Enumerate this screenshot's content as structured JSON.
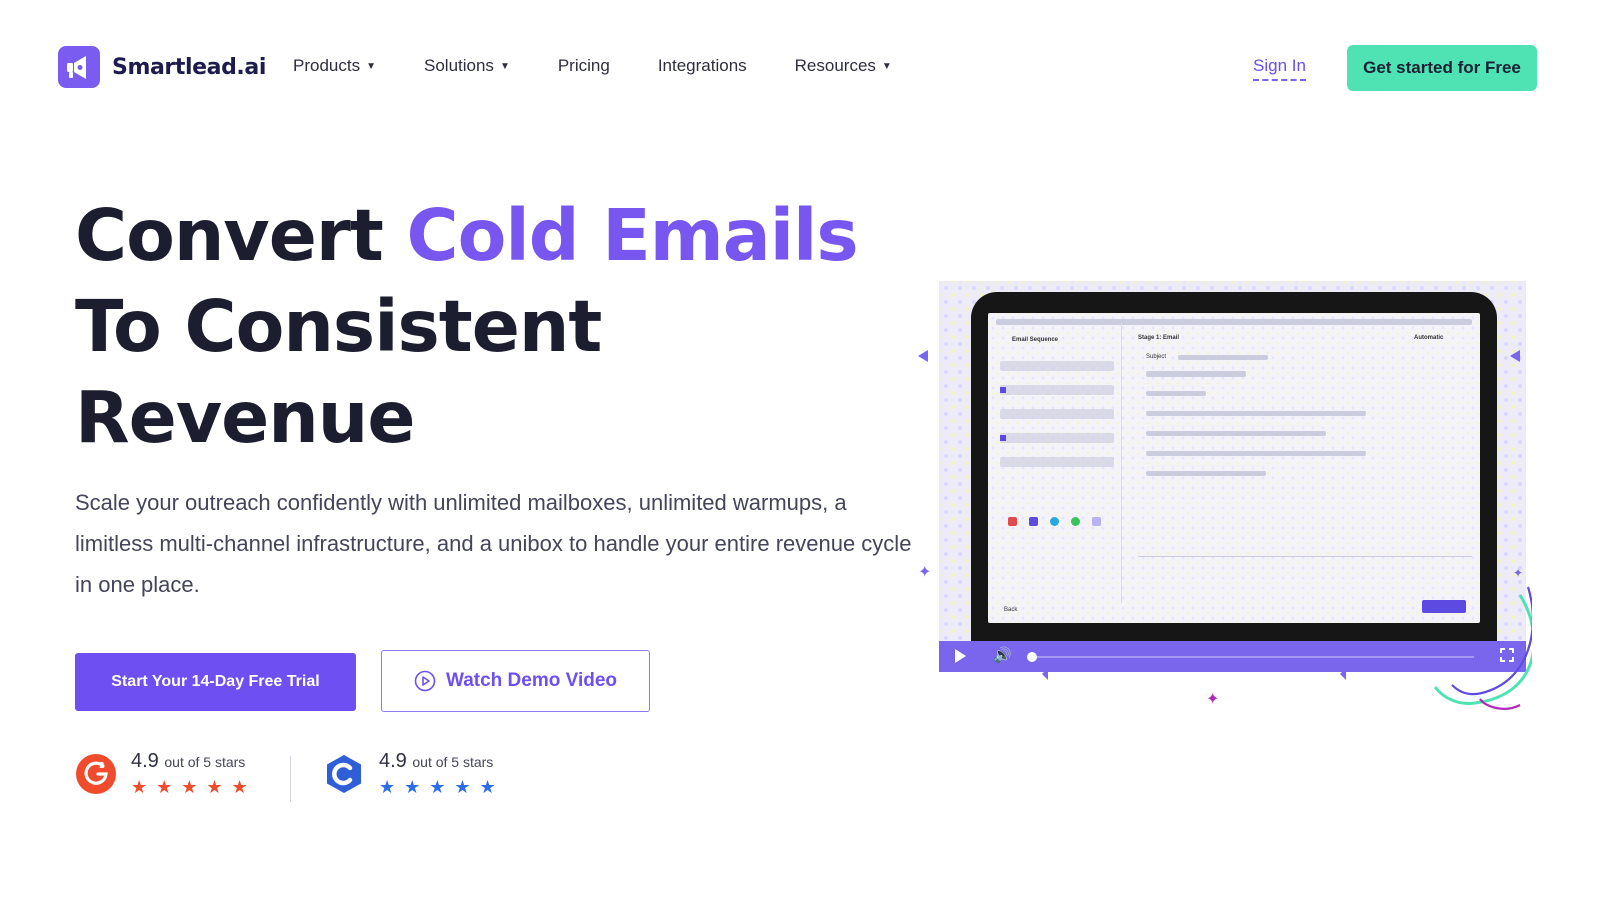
{
  "brand": {
    "name": "Smartlead.ai"
  },
  "nav": {
    "items": [
      {
        "label": "Products",
        "has_dropdown": true
      },
      {
        "label": "Solutions",
        "has_dropdown": true
      },
      {
        "label": "Pricing",
        "has_dropdown": false
      },
      {
        "label": "Integrations",
        "has_dropdown": false
      },
      {
        "label": "Resources",
        "has_dropdown": true
      }
    ],
    "chevron": "⌄",
    "sign_in": "Sign In",
    "cta": "Get started for Free"
  },
  "hero": {
    "title_part1": "Convert ",
    "title_accent": "Cold Emails",
    "title_line2": "To Consistent",
    "title_line3": "Revenue",
    "subtitle": "Scale your outreach confidently with unlimited mailboxes, unlimited warmups, a limitless multi-channel infrastructure, and a unibox to handle your entire revenue cycle in one place.",
    "primary_button": "Start Your 14-Day Free Trial",
    "secondary_button": "Watch Demo Video"
  },
  "ratings": [
    {
      "source_icon": "g2-logo-icon",
      "score": "4.9",
      "suffix": "out of 5 stars",
      "stars": "★★★★★",
      "star_count": 5,
      "color": "#ef4b2c"
    },
    {
      "source_icon": "capterra-logo-icon",
      "score": "4.9",
      "suffix": "out of 5 stars",
      "stars": "★★★★★",
      "star_count": 5,
      "color": "#2e6de8"
    }
  ],
  "video": {
    "screen_labels": {
      "sequence": "Email Sequence",
      "stage": "Stage 1: Email",
      "mode": "Automatic",
      "subject": "Subject",
      "back": "Back"
    },
    "controls": {
      "play_icon": "play-icon",
      "volume_icon": "volume-icon",
      "volume_glyph": "🔊",
      "progress": 0,
      "fullscreen_icon": "fullscreen-icon"
    }
  },
  "colors": {
    "brand_purple": "#6d4ff2",
    "accent_purple": "#7757ef",
    "mint_cta": "#4fe3b4",
    "heading": "#1c1d2e",
    "video_controls": "#7966ec"
  }
}
